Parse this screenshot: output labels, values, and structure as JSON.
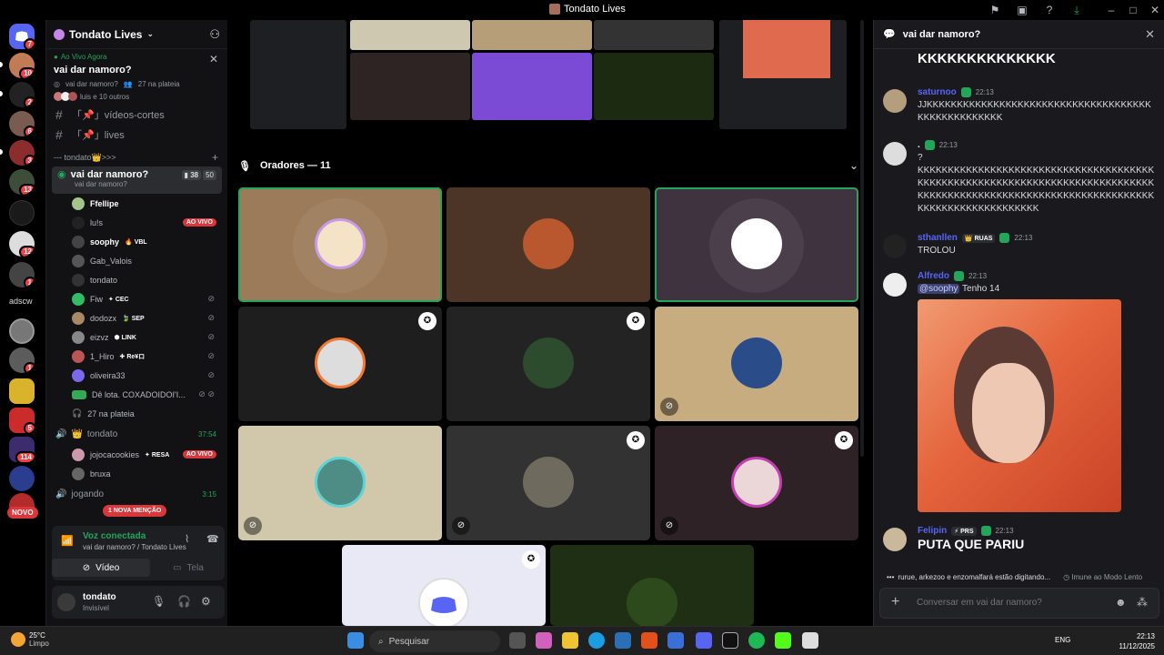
{
  "window": {
    "title": "Tondato Lives"
  },
  "guilds": {
    "badges": [
      "7",
      "10",
      "2",
      "6",
      "3",
      "13",
      "12",
      "1",
      "1",
      "5",
      "114"
    ],
    "text_label": "adscw",
    "new_label": "NOVO"
  },
  "sidebar": {
    "server_name": "Tondato Lives",
    "live_card": {
      "label": "Ao Vivo Agora",
      "title": "vai dar namoro?",
      "channel": "vai dar namoro?",
      "audience": "27 na plateia",
      "others": "luis e 10 outros"
    },
    "channels": [
      {
        "name": "「📌」vídeos-cortes"
      },
      {
        "name": "「📌」lives"
      }
    ],
    "category": "--- tondato👑>>>",
    "voice_channel": {
      "name": "vai dar namoro?",
      "status": "vai dar namoro?",
      "video_count": "38",
      "user_count": "50"
    },
    "members": [
      {
        "name": "Ffellipe",
        "tag": "",
        "live": "",
        "muted": false
      },
      {
        "name": "lu!s",
        "tag": "",
        "live": "AO VIVO",
        "muted": false
      },
      {
        "name": "soophy",
        "tag": "VBL",
        "live": "",
        "muted": false
      },
      {
        "name": "Gab_Valois",
        "tag": "",
        "live": "",
        "muted": false
      },
      {
        "name": "tondato",
        "tag": "",
        "live": "",
        "muted": false
      },
      {
        "name": "Fiw",
        "tag": "CEC",
        "live": "",
        "muted": true
      },
      {
        "name": "dodozx",
        "tag": "SEP",
        "live": "",
        "muted": true
      },
      {
        "name": "eizvz",
        "tag": "LINK",
        "live": "",
        "muted": true
      },
      {
        "name": "1_Hiro",
        "tag": "Re¥ロ",
        "live": "",
        "muted": true
      },
      {
        "name": "oliveira33",
        "tag": "",
        "live": "",
        "muted": true
      },
      {
        "name": "Dê lota. COXADOIDOI'I...",
        "tag": "",
        "live": "",
        "muted": true
      }
    ],
    "audience_row": "27 na plateia",
    "voice_channel_2": {
      "name": "tondato",
      "time": "37:54"
    },
    "members_2": [
      {
        "name": "jojocacookies",
        "tag": "RESA",
        "live": "AO VIVO"
      },
      {
        "name": "bruxa",
        "tag": "",
        "live": ""
      }
    ],
    "voice_channel_3": {
      "name": "jogando",
      "time": "3:15"
    },
    "mention_pill": "1 NOVA MENÇÃO",
    "voice_panel": {
      "status": "Voz conectada",
      "location": "vai dar namoro? / Tondato Lives",
      "video_label": "Vídeo",
      "screen_label": "Tela"
    },
    "user": {
      "name": "tondato",
      "status": "Invisível"
    }
  },
  "stage": {
    "speakers_label": "Oradores — 11"
  },
  "chat": {
    "title": "vai dar namoro?",
    "messages": [
      {
        "author": "",
        "time": "",
        "text": "KKKKKKKKKKKKKK",
        "color": "#ffffff"
      },
      {
        "author": "saturnoo",
        "time": "22:13",
        "text": "JJKKKKKKKKKKKKKKKKKKKKKKKKKKKKKKKKKKKKKKKKKKKKKKKKKKK",
        "color": "#5865f2"
      },
      {
        "author": ".",
        "time": "22:13",
        "text": "?",
        "text2": "KKKKKKKKKKKKKKKKKKKKKKKKKKKKKKKKKKKKKKKKKKKKKKKKKKKKKKKKKKKKKKKKKKKKKKKKKKKKKKKKKKKKKKKKKKKKKKKKKKKKKKKKKKKKKKKKKKKKKKKKKKKKKKKKKKKKKKKKK",
        "color": "#ffffff"
      },
      {
        "author": "sthanllen",
        "tag": "RUAS",
        "time": "22:13",
        "text": "TROLOU",
        "color": "#5865f2"
      },
      {
        "author": "Alfredo",
        "time": "22:13",
        "mention": "@soophy",
        "text": "Tenho 14",
        "color": "#5865f2"
      },
      {
        "author": "Felipin",
        "tag": "PRS",
        "time": "22:13",
        "text": "PUTA QUE PARIU",
        "color": "#5865f2"
      }
    ],
    "typing": "rurue, arkezoo e enzomalfará estão digitando...",
    "slow_mode": "Imune ao Modo Lento",
    "input_placeholder": "Conversar em vai dar namoro?"
  },
  "taskbar": {
    "temp": "25°C",
    "weather": "Limpo",
    "search_placeholder": "Pesquisar",
    "lang": "ENG",
    "time": "22:13",
    "date": "11/12/2025"
  }
}
